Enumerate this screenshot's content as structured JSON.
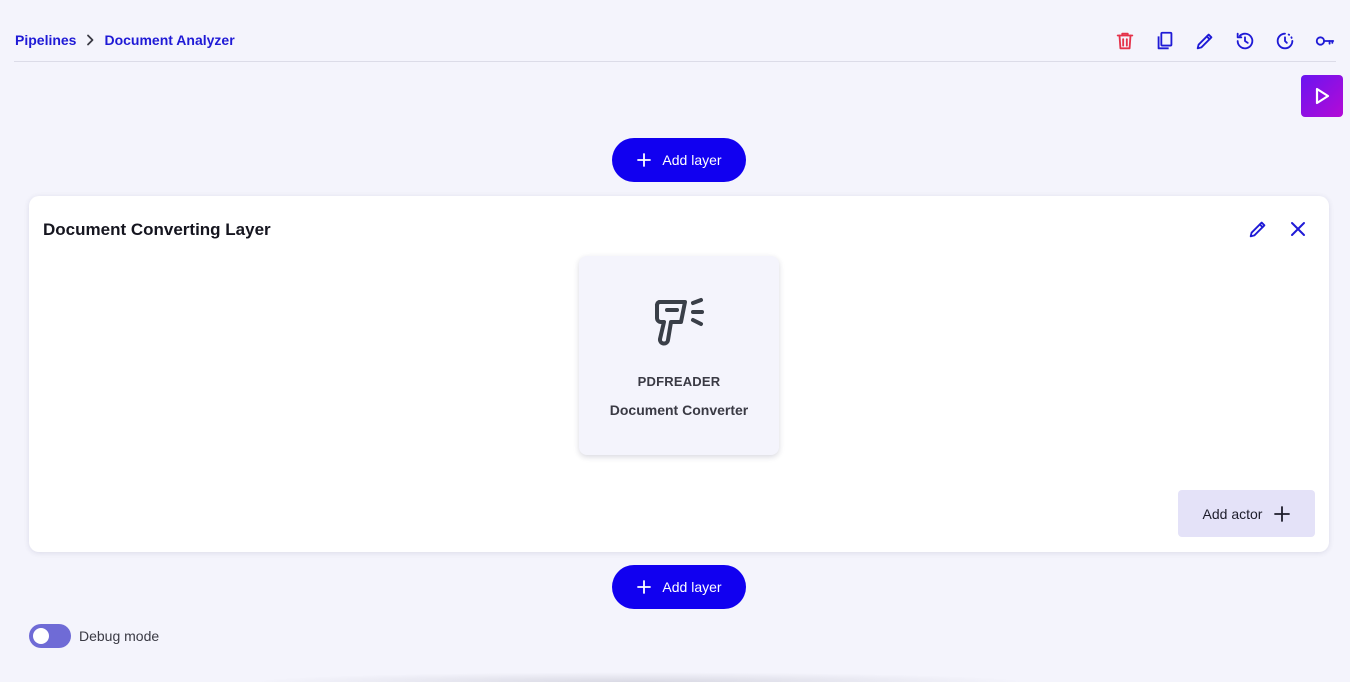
{
  "breadcrumb": {
    "root": "Pipelines",
    "current": "Document Analyzer"
  },
  "toolbar": {
    "icons": [
      "delete-icon",
      "copy-icon",
      "edit-icon",
      "history-icon",
      "schedule-icon",
      "key-icon"
    ],
    "colors": {
      "delete": "#e5334b",
      "default": "#1f1ad6"
    }
  },
  "run_button": {
    "icon": "play-icon",
    "color": "#8a12e6"
  },
  "add_layer_label": "Add layer",
  "layer": {
    "title": "Document Converting Layer",
    "actor": {
      "type": "PDFREADER",
      "name": "Document Converter",
      "icon": "barcode-scanner-icon"
    },
    "add_actor_label": "Add actor"
  },
  "debug": {
    "label": "Debug mode",
    "enabled": false
  },
  "colors": {
    "accent": "#1100f0",
    "background": "#f4f4fc"
  }
}
